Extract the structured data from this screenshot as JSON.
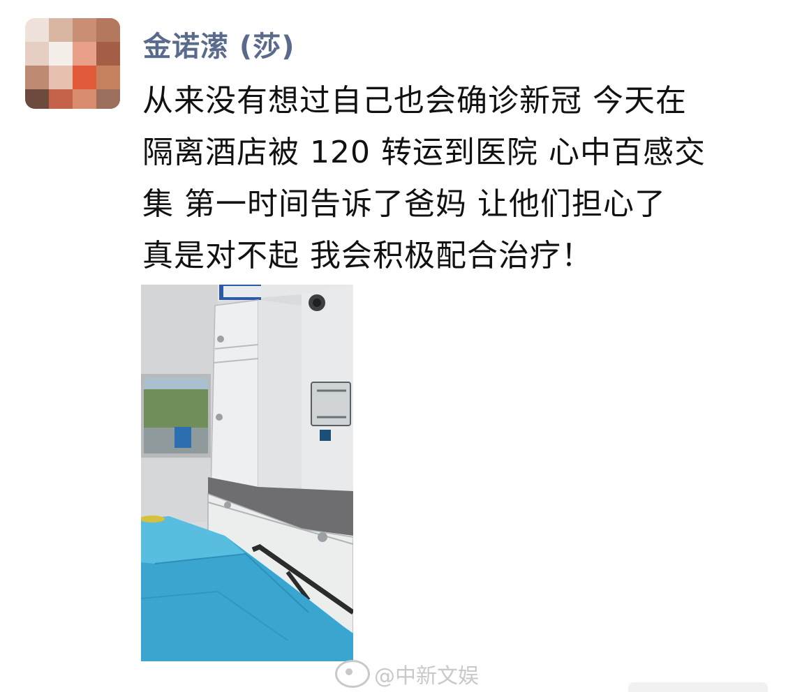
{
  "post": {
    "author_name": "金诺潆 (莎)",
    "content": "从来没有想过自己也会确诊新冠 今天在隔离酒店被120转运到医院 心中百感交集 第一时间告诉了爸妈 让他们担心了真是对不起 我会积极配合治疗！",
    "content_lines": [
      "从来没有想过自己也会确诊新冠 今天在",
      "隔离酒店被 120 转运到医院 心中百感交",
      "集 第一时间告诉了爸妈 让他们担心了",
      "真是对不起 我会积极配合治疗！"
    ]
  },
  "watermark": {
    "text": "@中新文娱",
    "icon": "weibo-logo-icon"
  },
  "colors": {
    "author_name": "#5a6a8c",
    "body_text": "#111111",
    "watermark": "#c9c9c9",
    "sheet_blue": "#3aa6cf"
  }
}
